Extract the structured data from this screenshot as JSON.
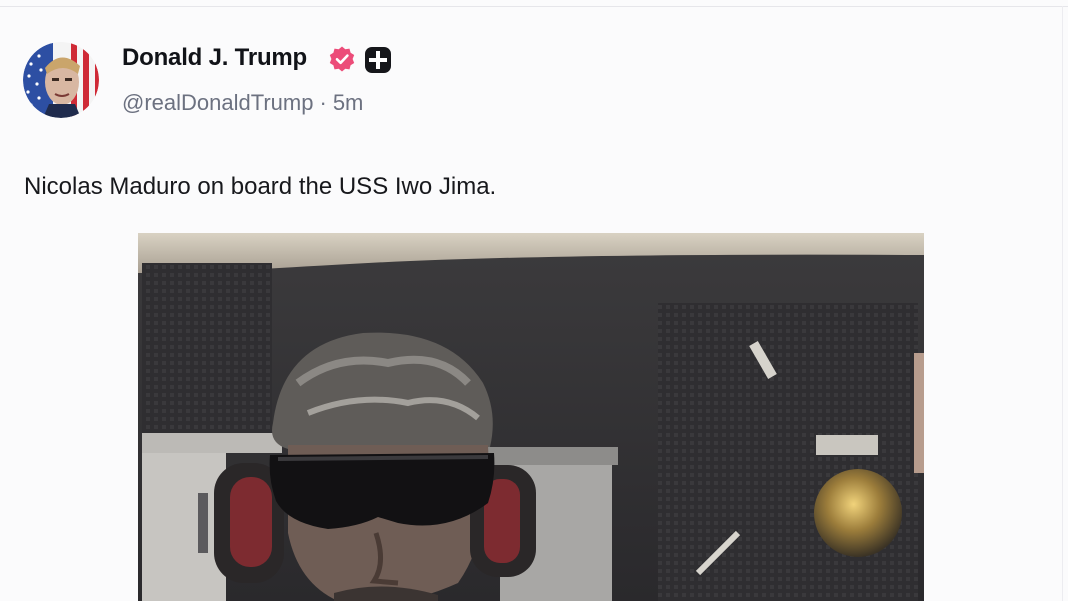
{
  "post": {
    "author": {
      "display_name": "Donald J. Trump",
      "handle": "@realDonaldTrump",
      "separator": "·",
      "timestamp": "5m",
      "verified": true,
      "avatar_icon": "flag-portrait-avatar"
    },
    "text": "Nicolas Maduro on board the USS Iwo Jima.",
    "media": {
      "type": "photo",
      "icon": "photo-image"
    }
  },
  "colors": {
    "verified_badge": "#ec4c79",
    "plus_badge": "#15161a",
    "name_text": "#111318",
    "handle_text": "#6c7180",
    "body_text": "#17181c"
  }
}
